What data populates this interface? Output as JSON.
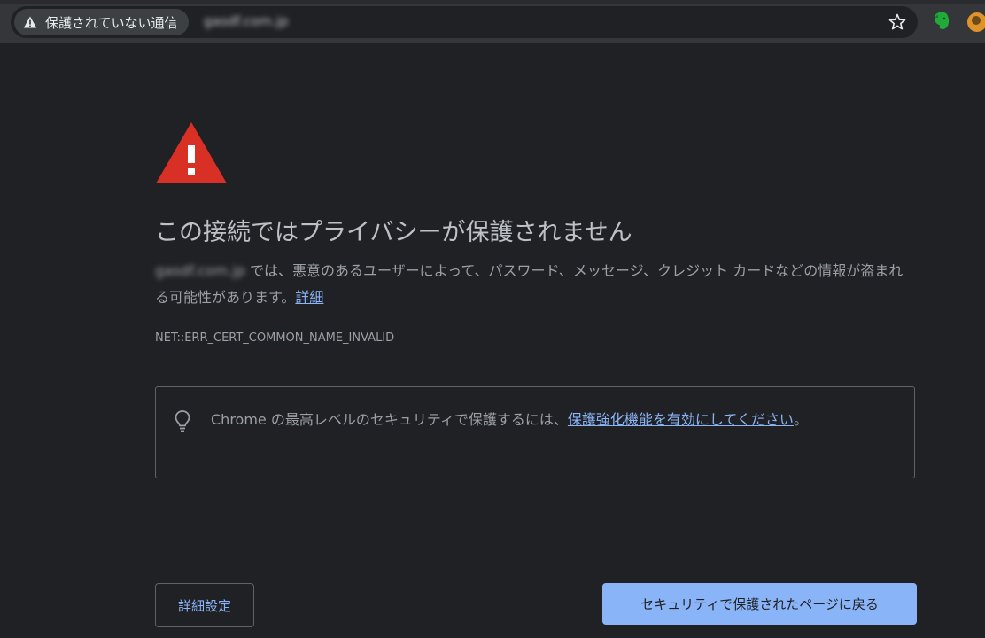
{
  "toolbar": {
    "security_chip_label": "保護されていない通信",
    "url": "gasdf.com.jp"
  },
  "interstitial": {
    "heading": "この接続ではプライバシーが保護されません",
    "host": "gasdf.com.jp",
    "explanation": " では、悪意のあるユーザーによって、パスワード、メッセージ、クレジット カードなどの情報が盗まれる可能性があります。",
    "details_link": "詳細",
    "error_code": "NET::ERR_CERT_COMMON_NAME_INVALID",
    "tip_text": "Chrome の最高レベルのセキュリティで保護するには、",
    "tip_link": "保護強化機能を有効にしてください",
    "tip_suffix": "。",
    "advanced_button": "詳細設定",
    "back_button": "セキュリティで保護されたページに戻る"
  },
  "colors": {
    "background": "#202124",
    "accent": "#8ab4f8",
    "warning_red": "#d93025"
  },
  "icons": {
    "warning": "warning-icon",
    "star": "star-icon",
    "lightbulb": "lightbulb-icon",
    "evernote": "evernote-extension-icon"
  }
}
